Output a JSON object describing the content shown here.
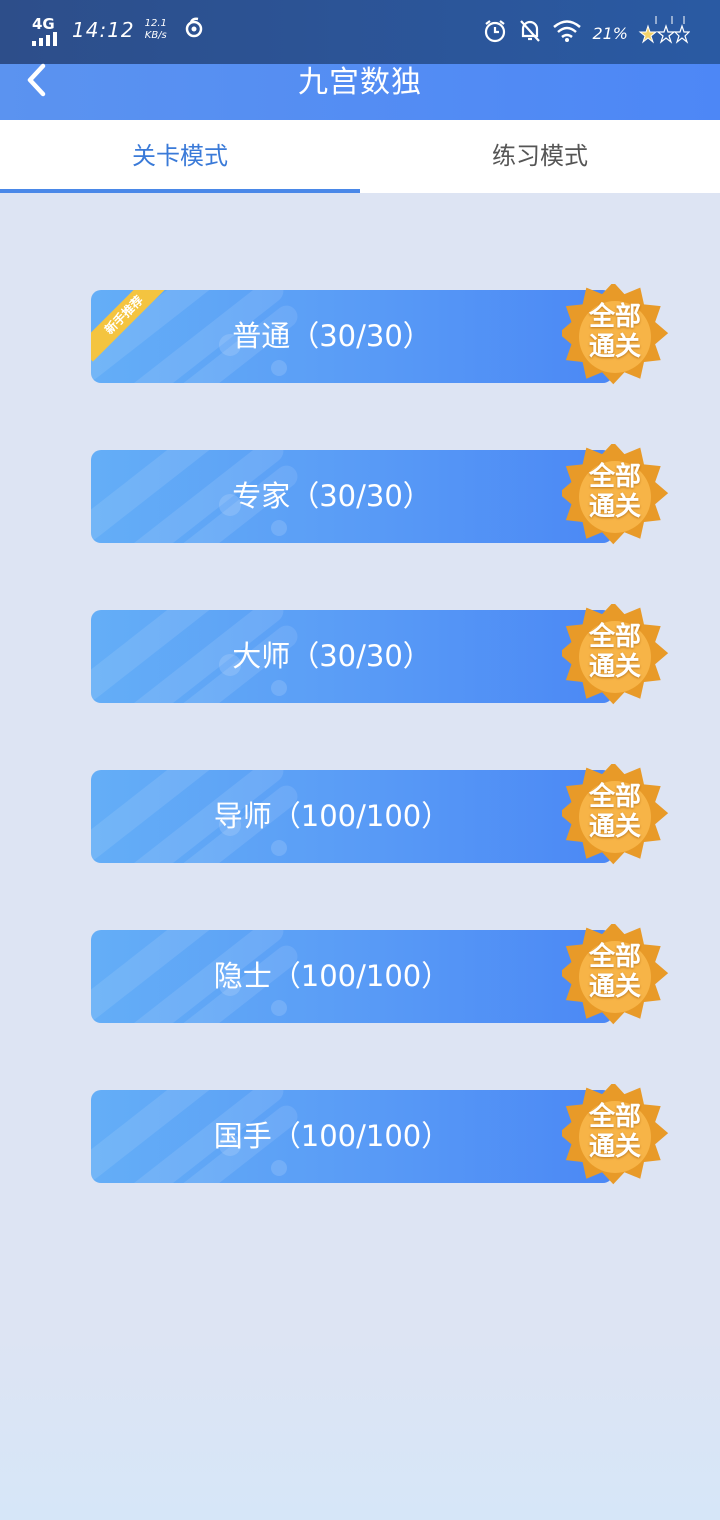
{
  "status_bar": {
    "network": "4G",
    "time": "14:12",
    "speed_value": "12.1",
    "speed_unit": "KB/s",
    "battery": "21%"
  },
  "header": {
    "title": "九宫数独",
    "back_icon": "chevron-left-icon"
  },
  "tabs": [
    {
      "label": "关卡模式",
      "active": true
    },
    {
      "label": "练习模式",
      "active": false
    }
  ],
  "levels": [
    {
      "label": "普通（30/30）",
      "completed": 30,
      "total": 30,
      "badge": [
        "全部",
        "通关"
      ],
      "ribbon": "新手推荐"
    },
    {
      "label": "专家（30/30）",
      "completed": 30,
      "total": 30,
      "badge": [
        "全部",
        "通关"
      ]
    },
    {
      "label": "大师（30/30）",
      "completed": 30,
      "total": 30,
      "badge": [
        "全部",
        "通关"
      ]
    },
    {
      "label": "导师（100/100）",
      "completed": 100,
      "total": 100,
      "badge": [
        "全部",
        "通关"
      ]
    },
    {
      "label": "隐士（100/100）",
      "completed": 100,
      "total": 100,
      "badge": [
        "全部",
        "通关"
      ]
    },
    {
      "label": "国手（100/100）",
      "completed": 100,
      "total": 100,
      "badge": [
        "全部",
        "通关"
      ]
    }
  ],
  "colors": {
    "accent": "#4a88e8",
    "header": "#4d87f6",
    "badge": "#f0a030"
  }
}
